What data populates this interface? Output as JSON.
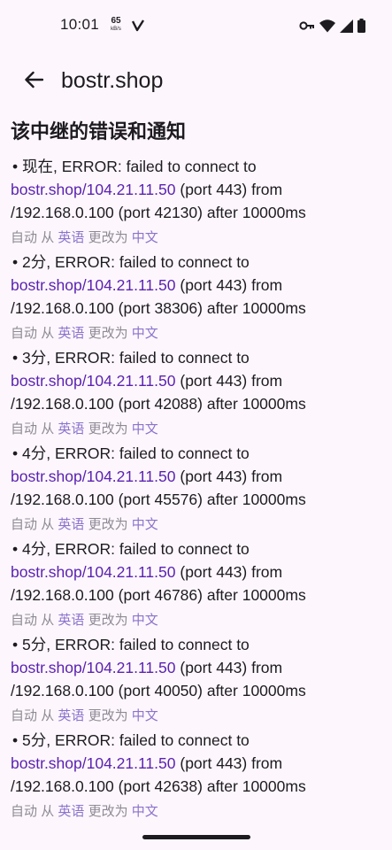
{
  "status_bar": {
    "time": "10:01",
    "net_speed_value": "65",
    "net_speed_unit": "kB/s",
    "icons": [
      "v-app-icon",
      "key-icon",
      "wifi-icon",
      "signal-icon",
      "battery-icon"
    ]
  },
  "app_bar": {
    "back_icon": "arrow-back-icon",
    "title": "bostr.shop"
  },
  "section": {
    "heading": "该中继的错误和通知"
  },
  "notifications": [
    {
      "time": "现在",
      "msg_prefix": ", ERROR: failed to connect to",
      "host": "bostr.shop/104.21.11.50",
      "port_text": " (port 443) from",
      "local_text": "/192.168.0.100 (port 42130) after 10000ms"
    },
    {
      "time": "2分",
      "msg_prefix": ", ERROR: failed to connect to",
      "host": "bostr.shop/104.21.11.50",
      "port_text": " (port 443) from",
      "local_text": "/192.168.0.100 (port 38306) after 10000ms"
    },
    {
      "time": "3分",
      "msg_prefix": ", ERROR: failed to connect to",
      "host": "bostr.shop/104.21.11.50",
      "port_text": " (port 443) from",
      "local_text": "/192.168.0.100 (port 42088) after 10000ms"
    },
    {
      "time": "4分",
      "msg_prefix": ", ERROR: failed to connect to",
      "host": "bostr.shop/104.21.11.50",
      "port_text": " (port 443) from",
      "local_text": "/192.168.0.100 (port 45576) after 10000ms"
    },
    {
      "time": "4分",
      "msg_prefix": ", ERROR: failed to connect to",
      "host": "bostr.shop/104.21.11.50",
      "port_text": " (port 443) from",
      "local_text": "/192.168.0.100 (port 46786) after 10000ms"
    },
    {
      "time": "5分",
      "msg_prefix": ", ERROR: failed to connect to",
      "host": "bostr.shop/104.21.11.50",
      "port_text": " (port 443) from",
      "local_text": "/192.168.0.100 (port 40050) after 10000ms"
    },
    {
      "time": "5分",
      "msg_prefix": ", ERROR: failed to connect to",
      "host": "bostr.shop/104.21.11.50",
      "port_text": " (port 443) from",
      "local_text": "/192.168.0.100 (port 42638) after 10000ms"
    }
  ],
  "translation": {
    "auto": "自动",
    "from": "从",
    "source_lang": "英语",
    "changed_to": "更改为",
    "target_lang": "中文"
  },
  "colors": {
    "background": "#fdf7fd",
    "text": "#1d1b20",
    "link": "#5b22b0",
    "muted": "#8e8a95",
    "accent": "#8c73cc"
  }
}
